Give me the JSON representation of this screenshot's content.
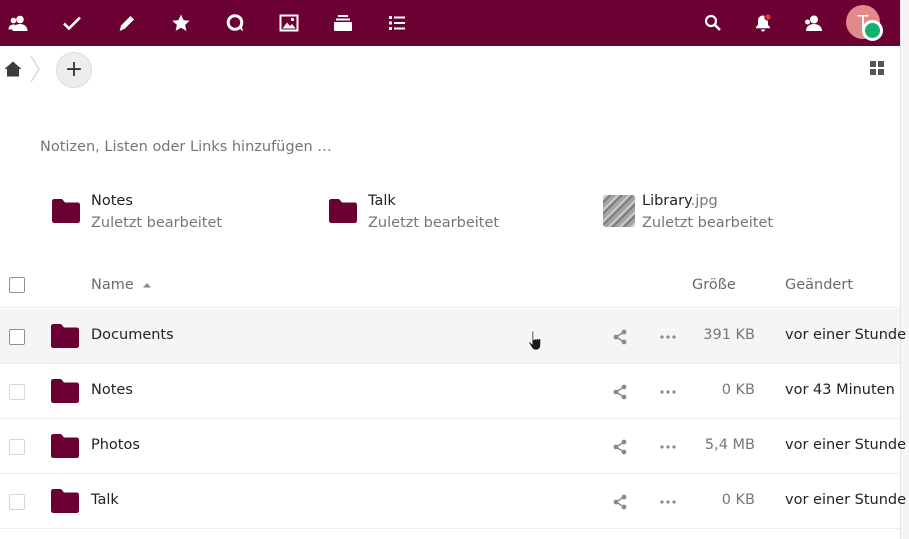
{
  "colors": {
    "brand": "#6b0033",
    "header_icon": "#ffffff",
    "folder": "#6b0033",
    "notification_dot": "#e9322d",
    "status_online": "#14b36b",
    "avatar_bg": "#e28a8a",
    "row_hover": "#f5f5f5"
  },
  "header": {
    "app_icons": [
      "contacts-icon",
      "tasks-checkmark-icon",
      "notes-pencil-icon",
      "favorites-star-icon",
      "talk-icon",
      "photos-icon",
      "deck-icon",
      "list-icon"
    ],
    "right_icons": [
      "search-icon",
      "notifications-bell-icon",
      "contacts-menu-icon"
    ],
    "avatar_letter": "T"
  },
  "breadcrumb": {
    "home_icon": "home-icon",
    "add_label": "+",
    "view_toggle_icon": "grid-view-icon"
  },
  "notes": {
    "placeholder": "Notizen, Listen oder Links hinzufügen …"
  },
  "recent": [
    {
      "name": "Notes",
      "ext": "",
      "subtitle": "Zuletzt bearbeitet",
      "icon": "folder-icon"
    },
    {
      "name": "Talk",
      "ext": "",
      "subtitle": "Zuletzt bearbeitet",
      "icon": "folder-icon"
    },
    {
      "name": "Library",
      "ext": ".jpg",
      "subtitle": "Zuletzt bearbeitet",
      "icon": "image-thumbnail"
    }
  ],
  "table": {
    "headers": {
      "name": "Name",
      "size": "Größe",
      "modified": "Geändert"
    },
    "sort_icon": "sort-ascending-icon",
    "rows": [
      {
        "name": "Documents",
        "size": "391 KB",
        "modified": "vor einer Stunde",
        "hovered": true
      },
      {
        "name": "Notes",
        "size": "0 KB",
        "modified": "vor 43 Minuten",
        "hovered": false
      },
      {
        "name": "Photos",
        "size": "5,4 MB",
        "modified": "vor einer Stunde",
        "hovered": false
      },
      {
        "name": "Talk",
        "size": "0 KB",
        "modified": "vor einer Stunde",
        "hovered": false
      }
    ]
  }
}
